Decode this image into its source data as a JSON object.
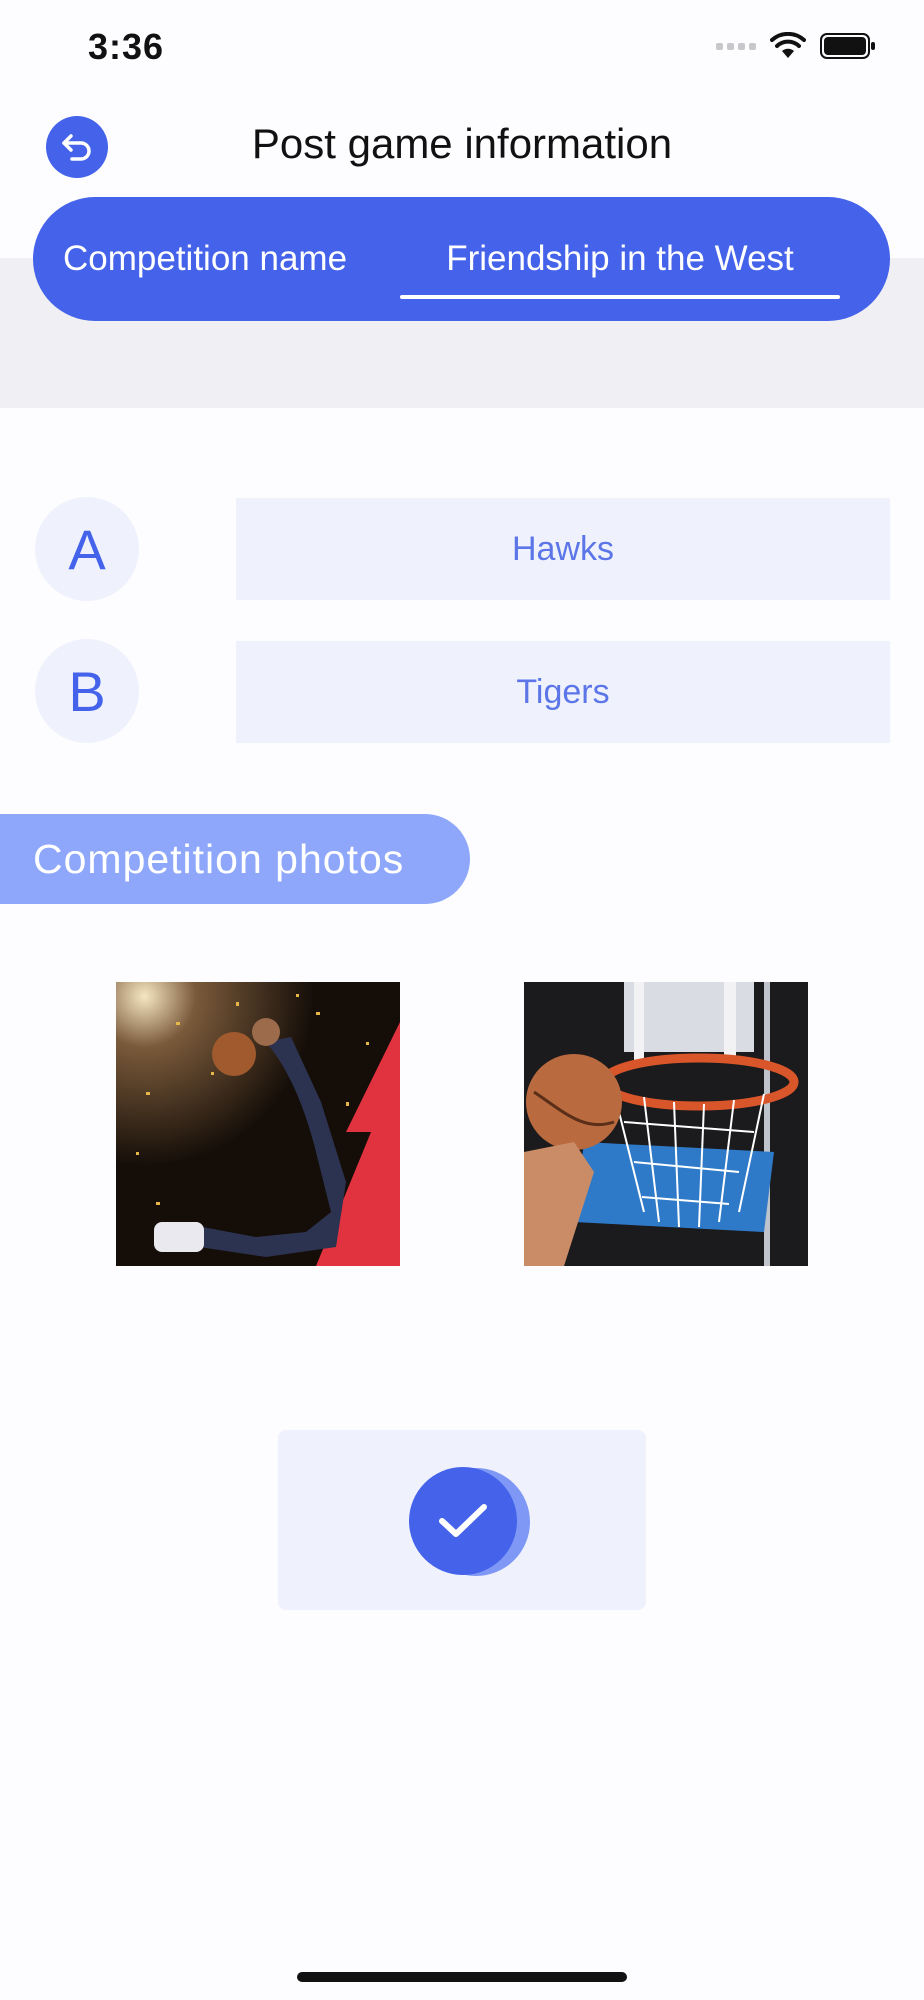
{
  "status_bar": {
    "time": "3:36"
  },
  "header": {
    "title": "Post game information",
    "back_icon": "back-arrow-icon"
  },
  "competition": {
    "label": "Competition name",
    "value": "Friendship in the West"
  },
  "teams": [
    {
      "letter": "A",
      "name": "Hawks"
    },
    {
      "letter": "B",
      "name": "Tigers"
    }
  ],
  "photos": {
    "title": "Competition photos",
    "items": [
      "basketball-dunk-photo",
      "basketball-hoop-photo"
    ]
  },
  "confirm": {
    "icon": "checkmark-icon"
  },
  "colors": {
    "accent": "#4563ea",
    "accent_light": "#8ea7fa",
    "field_bg": "#eff2fd",
    "band_bg": "#efeff4"
  }
}
